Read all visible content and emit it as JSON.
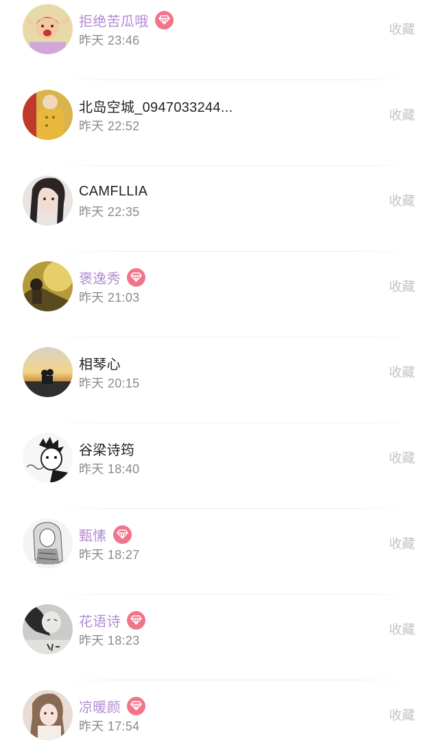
{
  "colors": {
    "vip_name": "#b38ad6",
    "normal_name": "#222222",
    "time": "#8a8a8e",
    "favorite": "#c4c4c8",
    "vip_badge": "#f2748a"
  },
  "items": [
    {
      "name": "拒绝苦瓜哦",
      "time": "昨天 23:46",
      "vip": true,
      "action": "收藏"
    },
    {
      "name": "北岛空城_0947033244...",
      "time": "昨天 22:52",
      "vip": false,
      "action": "收藏"
    },
    {
      "name": "CAMFLLIA",
      "time": "昨天 22:35",
      "vip": false,
      "action": "收藏"
    },
    {
      "name": "褒逸秀",
      "time": "昨天 21:03",
      "vip": true,
      "action": "收藏"
    },
    {
      "name": "相琴心",
      "time": "昨天 20:15",
      "vip": false,
      "action": "收藏"
    },
    {
      "name": "谷梁诗筠",
      "time": "昨天 18:40",
      "vip": false,
      "action": "收藏"
    },
    {
      "name": "甄愫",
      "time": "昨天 18:27",
      "vip": true,
      "action": "收藏"
    },
    {
      "name": "花语诗",
      "time": "昨天 18:23",
      "vip": true,
      "action": "收藏"
    },
    {
      "name": "凉暖颜",
      "time": "昨天 17:54",
      "vip": true,
      "action": "收藏"
    }
  ]
}
